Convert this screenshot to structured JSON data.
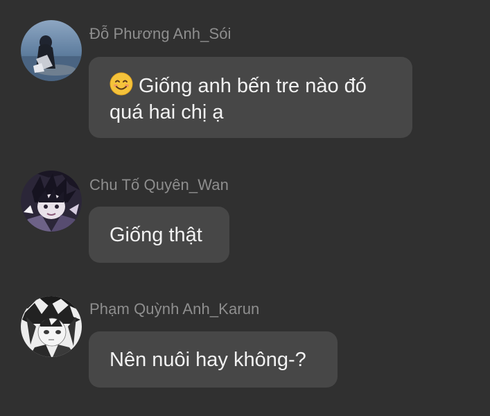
{
  "messages": [
    {
      "sender": "Đỗ Phương Anh_Sói",
      "avatar_icon": "avatar-girl-by-sea",
      "emoji_icon": "smiling-face-emoji",
      "text_line1": "Giống anh bến tre nào đó",
      "text_line2": "quá hai chị ạ"
    },
    {
      "sender": "Chu Tố Quyên_Wan",
      "avatar_icon": "avatar-anime-character-dark",
      "text": "Giống thật"
    },
    {
      "sender": "Phạm Quỳnh Anh_Karun",
      "avatar_icon": "avatar-anime-sketch",
      "text": "Nên nuôi hay không-?"
    }
  ],
  "colors": {
    "background": "#303030",
    "bubble": "#474747",
    "name_text": "#8e8e8e",
    "message_text": "#f2f2f2"
  }
}
